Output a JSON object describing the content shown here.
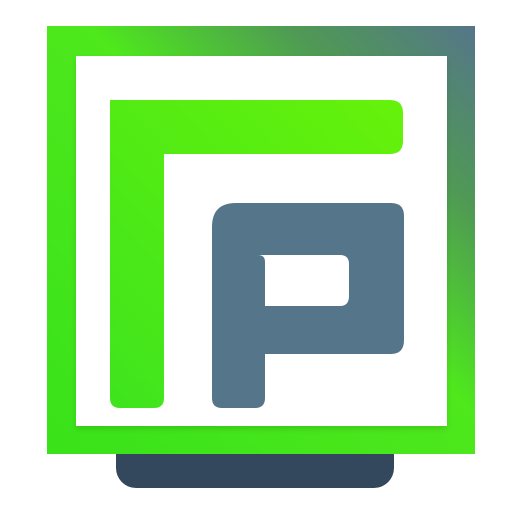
{
  "logo": {
    "icon_name": "ff-monitor-logo-icon",
    "colors": {
      "green": "#3ee51f",
      "green_bright": "#5cf00e",
      "slate": "#55758a",
      "slate_dark": "#33485c",
      "background": "#ffffff"
    }
  }
}
